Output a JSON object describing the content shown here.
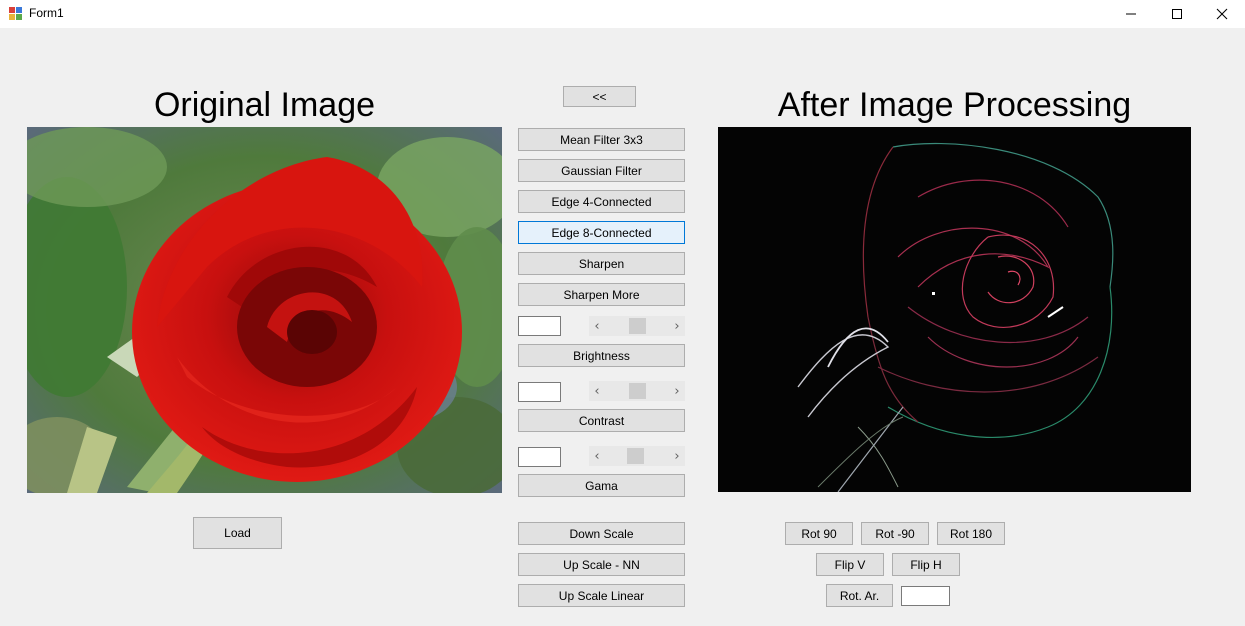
{
  "window": {
    "title": "Form1"
  },
  "headings": {
    "original": "Original Image",
    "processed": "After Image Processing"
  },
  "buttons": {
    "back": "<<",
    "mean_filter": "Mean Filter 3x3",
    "gaussian_filter": "Gaussian Filter",
    "edge4": "Edge 4-Connected",
    "edge8": "Edge 8-Connected",
    "sharpen": "Sharpen",
    "sharpen_more": "Sharpen More",
    "brightness": "Brightness",
    "contrast": "Contrast",
    "gama": "Gama",
    "load": "Load",
    "down_scale": "Down Scale",
    "up_scale_nn": "Up Scale - NN",
    "up_scale_linear": "Up Scale Linear",
    "rot90": "Rot 90",
    "rot_neg90": "Rot -90",
    "rot180": "Rot 180",
    "flip_v": "Flip V",
    "flip_h": "Flip H",
    "rot_ar": "Rot. Ar."
  },
  "inputs": {
    "brightness_value": "",
    "contrast_value": "",
    "gama_value": "",
    "rot_angle_value": ""
  },
  "scrollbars": {
    "arrow_left": "‹",
    "arrow_right": "›"
  },
  "colors": {
    "form_bg": "#f0f0f0",
    "button_bg": "#e1e1e1",
    "focus_border": "#0078d7"
  },
  "icons": {
    "app": "form-app-icon",
    "minimize": "minimize-icon",
    "maximize": "maximize-icon",
    "close": "close-icon"
  }
}
